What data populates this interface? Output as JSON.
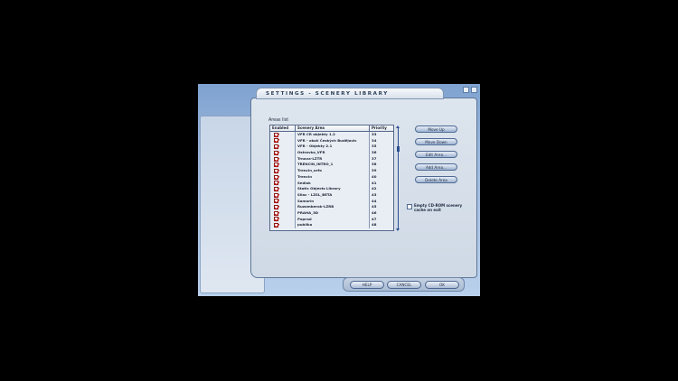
{
  "dialog": {
    "title": "SETTINGS - SCENERY LIBRARY"
  },
  "areas_list_label": "Areas list",
  "table": {
    "headers": [
      "Enabled",
      "Scenery Area",
      "Priority"
    ],
    "rows": [
      {
        "enabled": true,
        "name": "VFR CR objekty 1.2",
        "priority": "33"
      },
      {
        "enabled": true,
        "name": "VFR - okolí Českých Budějovic",
        "priority": "34"
      },
      {
        "enabled": true,
        "name": "VFR - Objekty 2.1",
        "priority": "35"
      },
      {
        "enabled": true,
        "name": "Ostrovka_VFR",
        "priority": "36"
      },
      {
        "enabled": true,
        "name": "Trnava-LZTR",
        "priority": "37"
      },
      {
        "enabled": true,
        "name": "TRENCIN_INTRO_1",
        "priority": "38"
      },
      {
        "enabled": true,
        "name": "Trencin_orfo",
        "priority": "39"
      },
      {
        "enabled": true,
        "name": "Trencin",
        "priority": "40"
      },
      {
        "enabled": true,
        "name": "Sedlak",
        "priority": "41"
      },
      {
        "enabled": true,
        "name": "Static Objects Library",
        "priority": "42"
      },
      {
        "enabled": true,
        "name": "Sliac - LZSL_BETA",
        "priority": "43"
      },
      {
        "enabled": true,
        "name": "Samorin",
        "priority": "44"
      },
      {
        "enabled": true,
        "name": "Ruzomberok-LZRB",
        "priority": "45"
      },
      {
        "enabled": true,
        "name": "PRAHA_3D",
        "priority": "46"
      },
      {
        "enabled": true,
        "name": "Poprad",
        "priority": "47"
      },
      {
        "enabled": true,
        "name": "publika",
        "priority": "48"
      }
    ]
  },
  "side_buttons": [
    "Move Up",
    "Move Down",
    "Edit Area...",
    "Add Area...",
    "Delete Area"
  ],
  "empty_cache": {
    "label": "Empty CD-ROM scenery cache on exit",
    "checked": false
  },
  "bottom_buttons": {
    "help": "HELP",
    "cancel": "CANCEL",
    "ok": "OK"
  }
}
